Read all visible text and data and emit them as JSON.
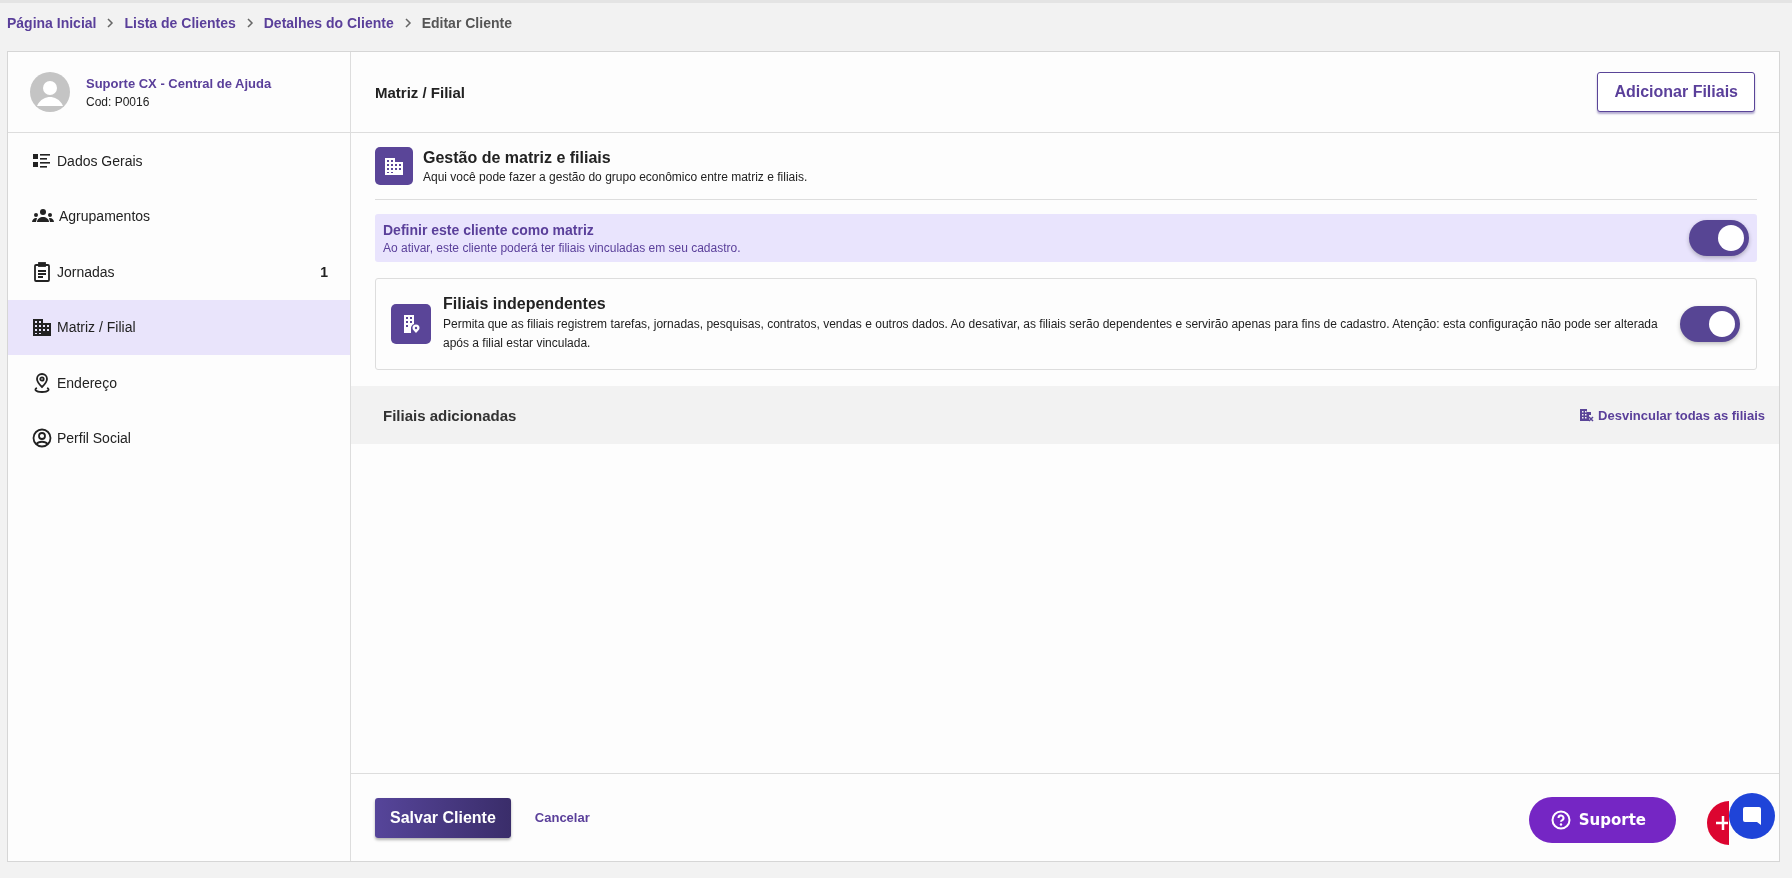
{
  "breadcrumb": [
    {
      "label": "Página Inicial",
      "current": false
    },
    {
      "label": "Lista de Clientes",
      "current": false
    },
    {
      "label": "Detalhes do Cliente",
      "current": false
    },
    {
      "label": "Editar Cliente",
      "current": true
    }
  ],
  "client": {
    "name": "Suporte CX - Central de Ajuda",
    "code": "Cod: P0016"
  },
  "sidebar": {
    "items": [
      {
        "label": "Dados Gerais",
        "selected": false
      },
      {
        "label": "Agrupamentos",
        "selected": false
      },
      {
        "label": "Jornadas",
        "selected": false,
        "count": "1"
      },
      {
        "label": "Matriz / Filial",
        "selected": true
      },
      {
        "label": "Endereço",
        "selected": false
      },
      {
        "label": "Perfil Social",
        "selected": false
      }
    ]
  },
  "panel": {
    "title": "Matriz / Filial",
    "add_button": "Adicionar Filiais",
    "section": {
      "title": "Gestão de matriz e filiais",
      "description": "Aqui você pode fazer a gestão do grupo econômico entre matriz e filiais."
    },
    "matrix_setting": {
      "title": "Definir este cliente como matriz",
      "description": "Ao ativar, este cliente poderá ter filiais vinculadas em seu cadastro.",
      "on": true
    },
    "independent_setting": {
      "title": "Filiais independentes",
      "description": "Permita que as filiais registrem tarefas, jornadas, pesquisas, contratos, vendas e outros dados. Ao desativar, as filiais serão dependentes e servirão apenas para fins de cadastro. Atenção: esta configuração não pode ser alterada após a filial estar vinculada.",
      "on": true
    },
    "added": {
      "title": "Filiais adicionadas",
      "unlink_link": "Desvincular todas as filiais"
    }
  },
  "footer": {
    "save_button": "Salvar Cliente",
    "cancel_link": "Cancelar"
  },
  "support_button": "Suporte"
}
